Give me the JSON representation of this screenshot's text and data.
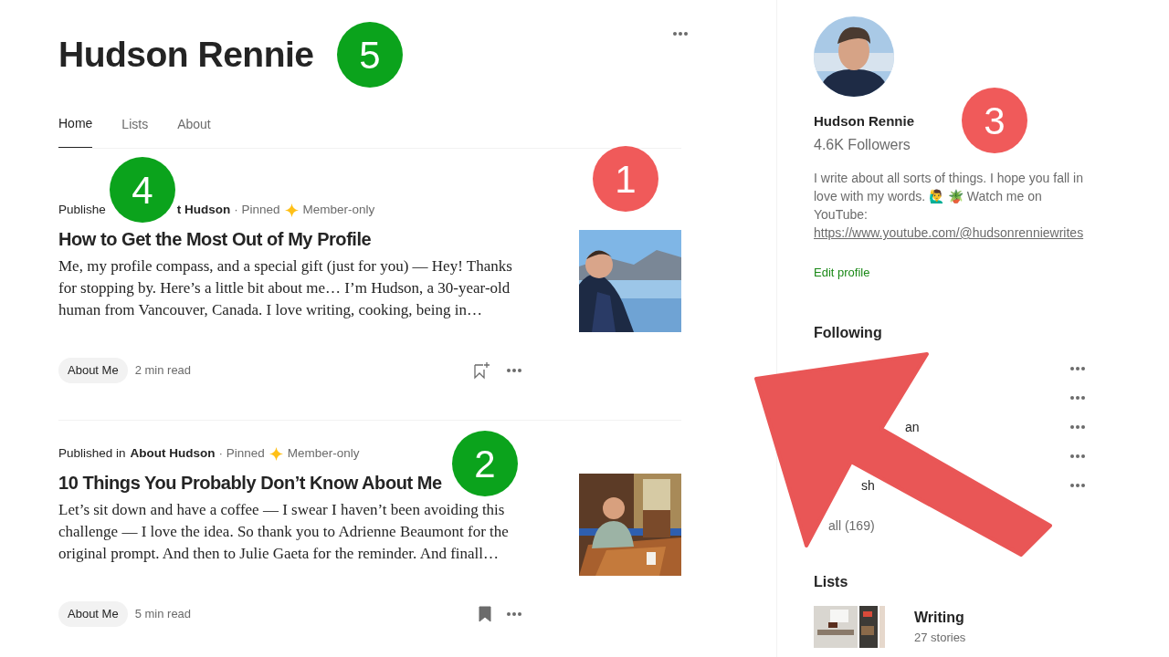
{
  "profile": {
    "name": "Hudson Rennie"
  },
  "tabs": [
    {
      "label": "Home",
      "selected": true
    },
    {
      "label": "Lists",
      "selected": false
    },
    {
      "label": "About",
      "selected": false
    }
  ],
  "posts": [
    {
      "prefix": "Publishe",
      "publication": "t Hudson",
      "prefix_covered": true,
      "pinned": "· Pinned",
      "member": "Member-only",
      "title": "How to Get the Most Out of My Profile",
      "excerpt": "Me, my profile compass, and a special gift (just for you) — Hey! Thanks for stopping by. Here’s a little bit about me… I’m Hudson, a 30-year-old human from Vancouver, Canada. I love writing, cooking, being in…",
      "tag": "About Me",
      "read_time": "2 min read",
      "saved": false
    },
    {
      "prefix": "Published in",
      "publication": "About Hudson",
      "prefix_covered": false,
      "pinned": "· Pinned",
      "member": "Member-only",
      "title": "10 Things You Probably Don’t Know About Me",
      "excerpt": "Let’s sit down and have a coffee — I swear I haven’t been avoiding this challenge — I love the idea. So thank you to Adrienne Beaumont for the original prompt. And then to Julie Gaeta for the reminder. And finall…",
      "tag": "About Me",
      "read_time": "5 min read",
      "saved": true
    }
  ],
  "sidebar": {
    "name": "Hudson Rennie",
    "followers": "4.6K Followers",
    "bio": "I write about all sorts of things. I hope you fall in love with my words. 🙋‍♂️ 🪴 Watch me on YouTube:",
    "link": "https://www.youtube.com/@hudsonrenniewrites",
    "edit": "Edit profile",
    "following_heading": "Following",
    "following": [
      {
        "kind": "covered"
      },
      {
        "kind": "covered"
      },
      {
        "kind": "partial",
        "name": "an"
      },
      {
        "kind": "covered"
      },
      {
        "kind": "partial",
        "name": "sh"
      }
    ],
    "see_all": "all (169)",
    "lists_heading": "Lists",
    "lists": [
      {
        "title": "Writing",
        "count": "27 stories"
      }
    ]
  },
  "annotations": {
    "markers": [
      {
        "label": "5",
        "color": "#0ba31c"
      },
      {
        "label": "3",
        "color": "#f05a5a"
      },
      {
        "label": "1",
        "color": "#f05a5a"
      },
      {
        "label": "4",
        "color": "#0ba31c"
      },
      {
        "label": "2",
        "color": "#0ba31c"
      }
    ],
    "arrow": {
      "color": "#e95656"
    }
  }
}
